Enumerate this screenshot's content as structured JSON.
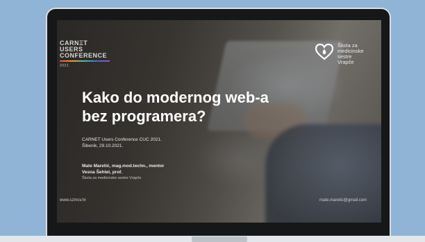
{
  "slide": {
    "conference_logo": {
      "line1": "CARNΞT",
      "line2": "USERS",
      "line3": "CONFERENCE",
      "year": "2021"
    },
    "school_name": {
      "line1": "Škola za",
      "line2": "medicinske",
      "line3": "sestre",
      "line4": "Vrapče"
    },
    "title_line1": "Kako do modernog web-a",
    "title_line2": "bez programera?",
    "subtitle_line1": "CARNET Users Conference CUC 2021.",
    "subtitle_line2": "Šibenik, 29.10.2021.",
    "author1": "Mate Maretić, mag.mod.techn., mentor",
    "author2": "Vesna Šehtel, prof.",
    "institution": "Škola za medicinske sestre Vrapče",
    "footer_website": "www.szmsv.hr",
    "footer_email": "mate.maretic@gmail.com"
  },
  "colors": {
    "page_background": "#8fb4d6",
    "monitor_bezel": "#151719",
    "title_text": "#ffffff"
  }
}
